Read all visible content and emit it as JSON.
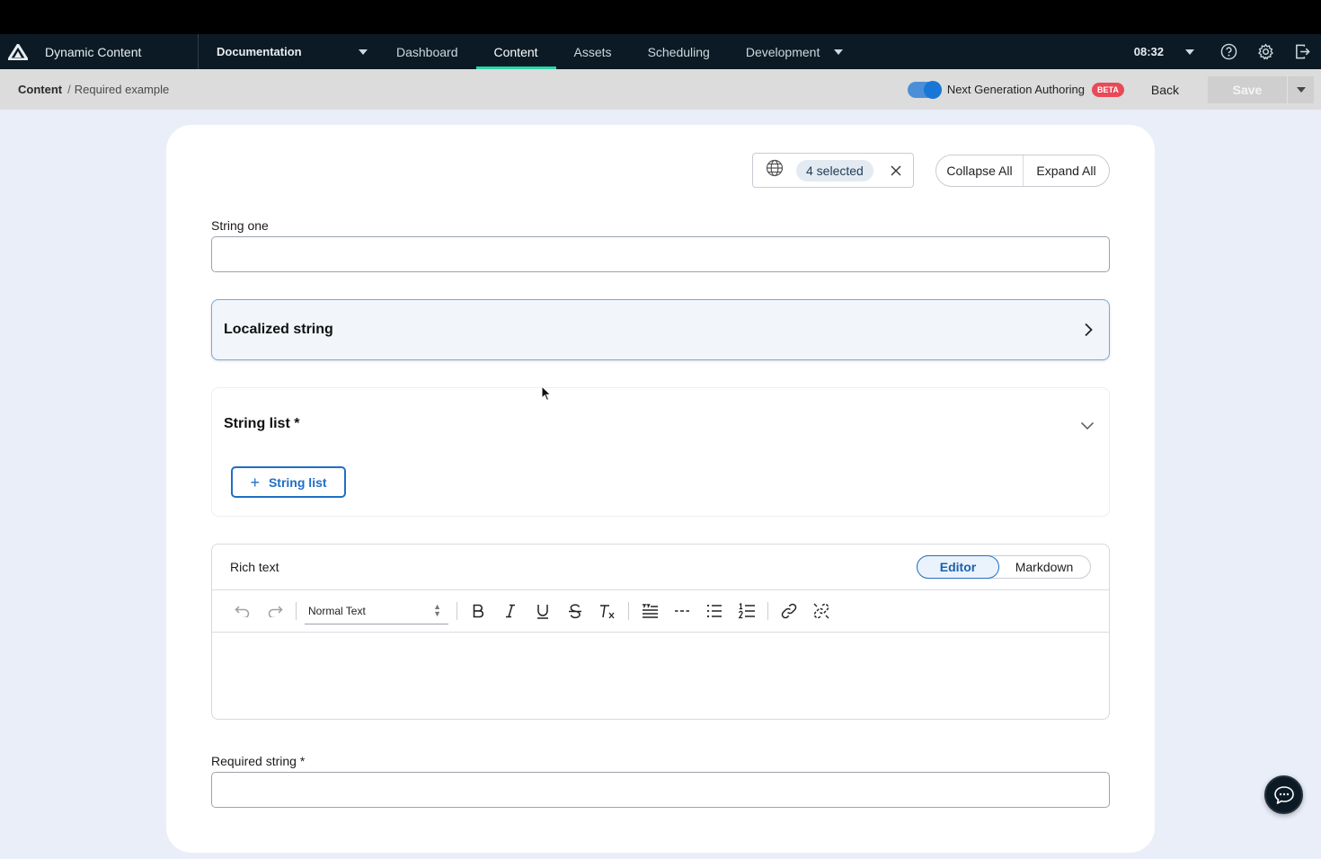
{
  "nav": {
    "app_name": "Dynamic Content",
    "hub_selector": "Documentation",
    "tabs": [
      {
        "label": "Dashboard"
      },
      {
        "label": "Content"
      },
      {
        "label": "Assets"
      },
      {
        "label": "Scheduling"
      },
      {
        "label": "Development"
      }
    ],
    "active_tab": "Content",
    "time": "08:32",
    "icons": [
      "logo-icon",
      "help-icon",
      "gear-icon",
      "logout-icon"
    ],
    "accent_color": "#2dd4a7"
  },
  "breadcrumb": {
    "root": "Content",
    "separator": "/",
    "current": "Required example"
  },
  "toolbar": {
    "nga_label": "Next Generation Authoring",
    "nga_enabled": true,
    "beta_badge": "BETA",
    "back_label": "Back",
    "save_label": "Save",
    "save_enabled": false
  },
  "locale": {
    "selected_chip": "4 selected"
  },
  "expand_controls": {
    "collapse_label": "Collapse All",
    "expand_label": "Expand All"
  },
  "fields": {
    "string_one": {
      "label": "String one",
      "value": ""
    },
    "localized_string": {
      "title": "Localized string",
      "collapsed": true
    },
    "string_list": {
      "title": "String list *",
      "add_label": "String list"
    },
    "rich_text": {
      "label": "Rich text",
      "modes": [
        "Editor",
        "Markdown"
      ],
      "active_mode": "Editor",
      "format": "Normal Text",
      "value": ""
    },
    "required_string": {
      "label": "Required string *",
      "value": ""
    }
  }
}
